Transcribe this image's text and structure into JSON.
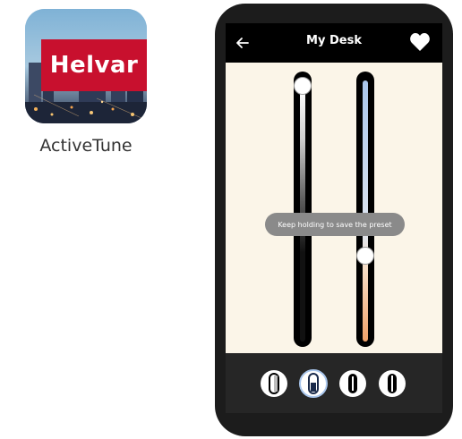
{
  "app": {
    "brand": "Helvar",
    "name": "ActiveTune"
  },
  "header": {
    "back_icon": "back-arrow-icon",
    "title": "My Desk",
    "favorite_icon": "heart-icon"
  },
  "sliders": {
    "brightness": {
      "level": 0.95
    },
    "color_temperature": {
      "level": 0.35
    }
  },
  "toast": "Keep holding to save the preset",
  "presets": [
    {
      "name": "preset-1"
    },
    {
      "name": "preset-2"
    },
    {
      "name": "preset-3"
    },
    {
      "name": "preset-4"
    }
  ],
  "colors": {
    "brand_red": "#c8102e",
    "warm_orange": "#f2a36b",
    "cool_blue": "#a9c6ec",
    "screen_bg": "#fbf5e8"
  }
}
